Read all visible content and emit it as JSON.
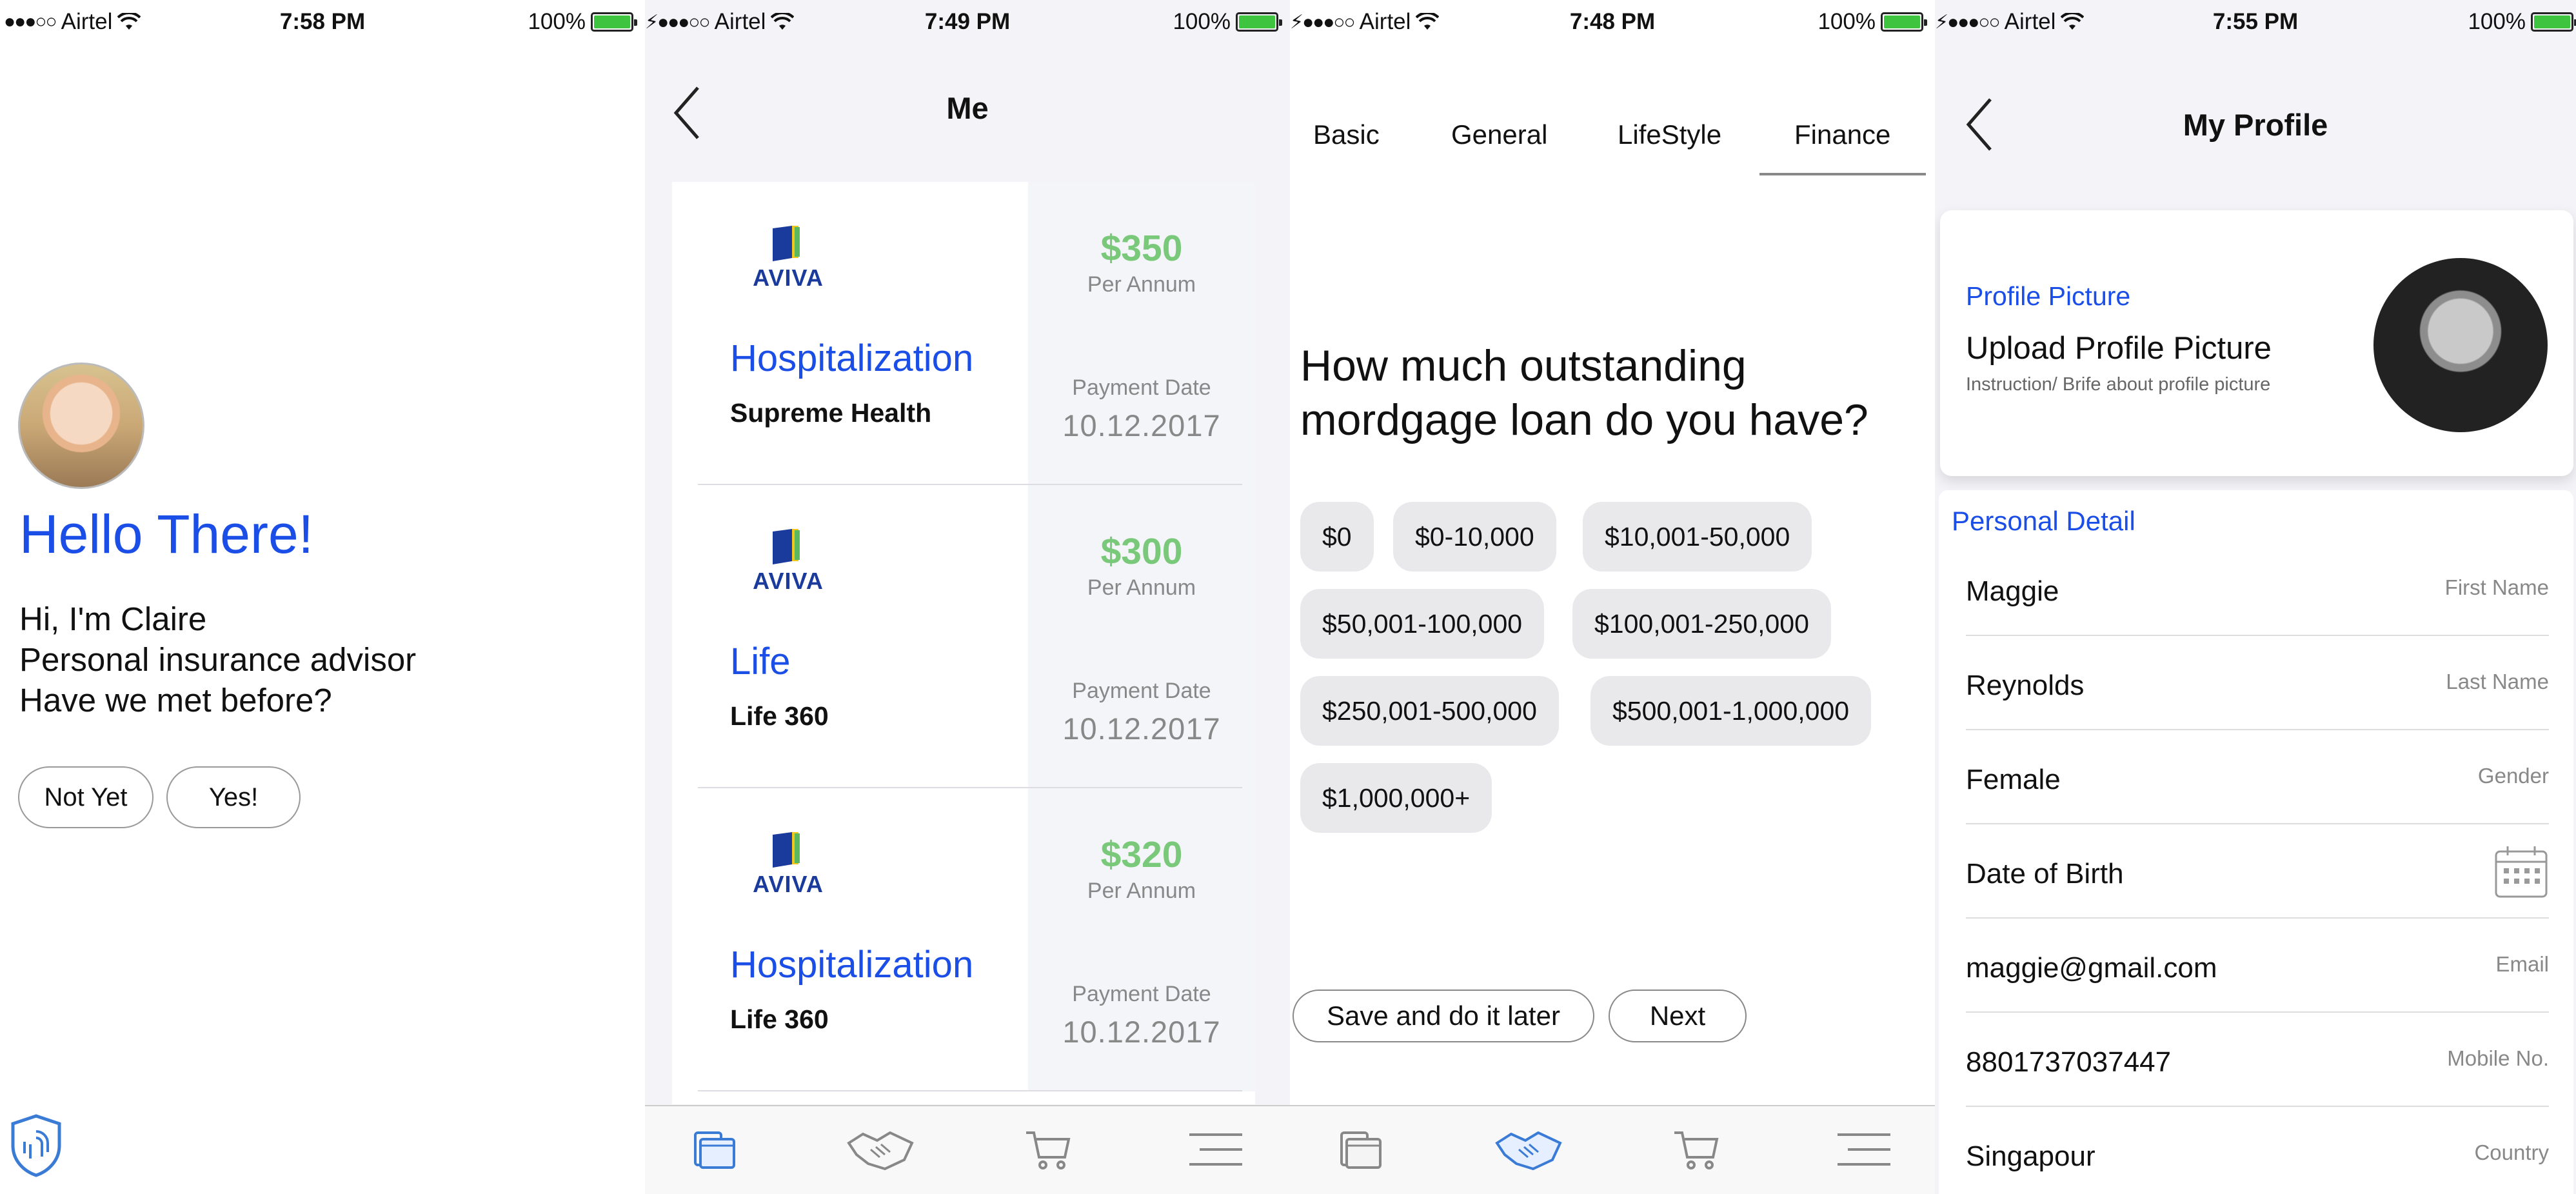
{
  "status_bars": [
    {
      "carrier": "Airtel",
      "time": "7:58 PM",
      "battery": "100%"
    },
    {
      "carrier": "Airtel",
      "time": "7:49 PM",
      "battery": "100%"
    },
    {
      "carrier": "Airtel",
      "time": "7:48 PM",
      "battery": "100%"
    },
    {
      "carrier": "Airtel",
      "time": "7:55 PM",
      "battery": "100%"
    }
  ],
  "welcome": {
    "title": "Hello There!",
    "lines": [
      "Hi, I'm Claire",
      "Personal insurance advisor",
      "Have we met before?"
    ],
    "buttons": {
      "not_yet": "Not Yet",
      "yes": "Yes!"
    }
  },
  "me": {
    "title": "Me",
    "policies": [
      {
        "provider": "AVIVA",
        "type": "Hospitalization",
        "name": "Supreme Health",
        "amount": "$350",
        "period": "Per Annum",
        "payment_label": "Payment Date",
        "payment_date": "10.12.2017"
      },
      {
        "provider": "AVIVA",
        "type": "Life",
        "name": "Life 360",
        "amount": "$300",
        "period": "Per Annum",
        "payment_label": "Payment Date",
        "payment_date": "10.12.2017"
      },
      {
        "provider": "AVIVA",
        "type": "Hospitalization",
        "name": "Life 360",
        "amount": "$320",
        "period": "Per Annum",
        "payment_label": "Payment Date",
        "payment_date": "10.12.2017"
      }
    ]
  },
  "questionnaire": {
    "tabs": [
      "Basic",
      "General",
      "LifeStyle",
      "Finance"
    ],
    "active_tab": "Finance",
    "question": "How much outstanding mordgage loan do you have?",
    "options": [
      "$0",
      "$0-10,000",
      "$10,001-50,000",
      "$50,001-100,000",
      "$100,001-250,000",
      "$250,001-500,000",
      "$500,001-1,000,000",
      "$1,000,000+"
    ],
    "save_later": "Save and do it later",
    "next": "Next"
  },
  "profile": {
    "title": "My Profile",
    "picture_label": "Profile Picture",
    "picture_title": "Upload Profile Picture",
    "picture_sub": "Instruction/ Brife about profile picture",
    "section": "Personal Detail",
    "fields": [
      {
        "value": "Maggie",
        "label": "First Name"
      },
      {
        "value": "Reynolds",
        "label": "Last Name"
      },
      {
        "value": "Female",
        "label": "Gender"
      },
      {
        "value": "Date of Birth",
        "label": ""
      },
      {
        "value": "maggie@gmail.com",
        "label": "Email"
      },
      {
        "value": "8801737037447",
        "label": "Mobile No."
      },
      {
        "value": "Singapour",
        "label": "Country"
      }
    ]
  },
  "colors": {
    "accent": "#1a4ee6",
    "amount": "#7ac97a",
    "battery": "#3ec43e"
  }
}
